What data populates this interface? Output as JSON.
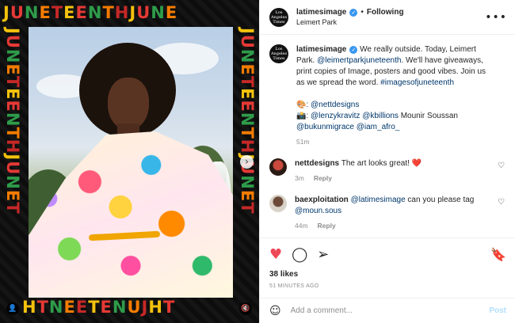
{
  "media": {
    "frame_text": "JUNETEENTH",
    "carousel_next_icon": "chevron-right-icon",
    "user_tag_icon": "user-tag-icon",
    "mute_icon": "speaker-muted-icon"
  },
  "header": {
    "avatar_text": "Los Angeles Times",
    "username": "latimesimage",
    "separator": "•",
    "follow_status": "Following",
    "location": "Leimert Park",
    "more_icon": "•••"
  },
  "caption": {
    "username": "latimesimage",
    "text_1": " We really outside. Today, Leimert Park. ",
    "mention_1": "@leimertparkjuneteenth",
    "text_2": ". We'll have giveaways, print copies of Image, posters and good vibes. Join us as we spread the word. ",
    "hashtag": "#imagesofjuneteenth",
    "credit_1_emoji": "🎨",
    "credit_1_mention": "@nettdesigns",
    "credit_2_emoji": "📸",
    "credit_2_mention_a": "@lenzykravitz",
    "credit_2_mention_b": "@kbillions",
    "credit_2_name": " Mounir Soussan ",
    "credit_2_mention_c": "@bukunmigrace",
    "credit_2_mention_d": "@iam_afro_",
    "time": "51m"
  },
  "comments": [
    {
      "username": "nettdesigns",
      "text": " The art looks great! ",
      "emoji": "❤️",
      "time": "3m",
      "reply": "Reply"
    },
    {
      "username": "baexploitation",
      "mention": "@latimesimage",
      "text": " can you please tag ",
      "mention_2": "@moun.sous",
      "time": "44m",
      "reply": "Reply"
    }
  ],
  "actions": {
    "likes": "38 likes",
    "timestamp": "51 MINUTES AGO"
  },
  "composer": {
    "placeholder": "Add a comment...",
    "post_label": "Post"
  },
  "colors": {
    "verified": "#3897f0",
    "link": "#00376b",
    "like": "#ed4956",
    "post_disabled": "#b2dffc"
  }
}
